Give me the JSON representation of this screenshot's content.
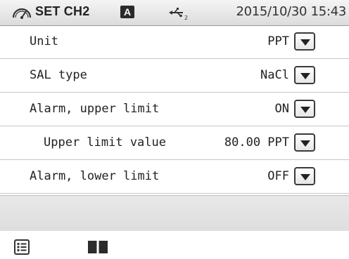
{
  "status_bar": {
    "title": "SET CH2",
    "channel_badge": "A",
    "datetime": "2015/10/30 15:43",
    "icons": [
      "gauge-icon",
      "usb-icon"
    ]
  },
  "settings": [
    {
      "label": "Unit",
      "value": "PPT"
    },
    {
      "label": "SAL type",
      "value": "NaCl"
    },
    {
      "label": "Alarm, upper limit",
      "value": "ON"
    },
    {
      "label": "Upper limit value",
      "value": "80.00 PPT"
    },
    {
      "label": "Alarm, lower limit",
      "value": "OFF"
    }
  ],
  "bottom_bar": {
    "icons": [
      "menu-list-icon",
      "manual-book-icon"
    ]
  },
  "colors": {
    "status_bar_bg": "#dcdcdc",
    "row_divider": "#c6c6c6",
    "empty_band": "#e4e4e4"
  }
}
